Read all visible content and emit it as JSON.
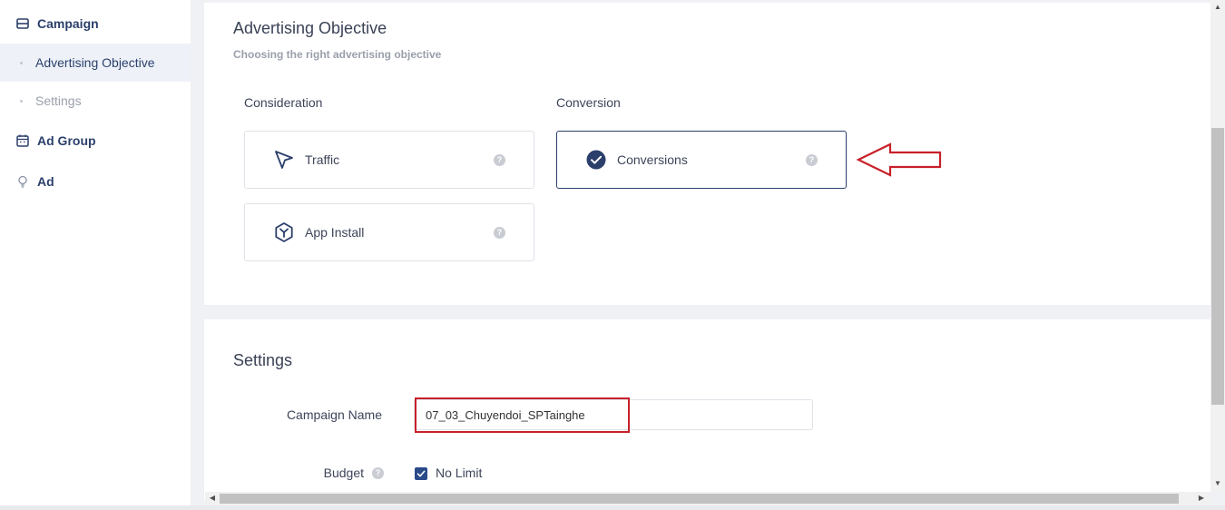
{
  "sidebar": {
    "campaign": {
      "label": "Campaign",
      "icon": "campaign-icon"
    },
    "advertising_objective": {
      "label": "Advertising Objective"
    },
    "settings": {
      "label": "Settings"
    },
    "ad_group": {
      "label": "Ad Group",
      "icon": "calendar-icon"
    },
    "ad": {
      "label": "Ad",
      "icon": "lightbulb-icon"
    }
  },
  "objective": {
    "title": "Advertising Objective",
    "subtitle": "Choosing the right advertising objective",
    "consideration_label": "Consideration",
    "conversion_label": "Conversion",
    "options": {
      "traffic": {
        "label": "Traffic",
        "icon": "cursor-arrow-icon"
      },
      "app_install": {
        "label": "App Install",
        "icon": "hexagon-y-icon"
      },
      "conversions": {
        "label": "Conversions",
        "icon": "check-circle-icon",
        "selected": true
      }
    },
    "help_glyph": "?"
  },
  "settings": {
    "title": "Settings",
    "campaign_name_label": "Campaign Name",
    "campaign_name_value": "07_03_Chuyendoi_SPTainghe",
    "budget_label": "Budget",
    "no_limit_label": "No Limit",
    "no_limit_checked": true
  },
  "colors": {
    "accent": "#2b3f6b",
    "annotation_red": "#c8202a",
    "background": "#f0f1f4"
  }
}
